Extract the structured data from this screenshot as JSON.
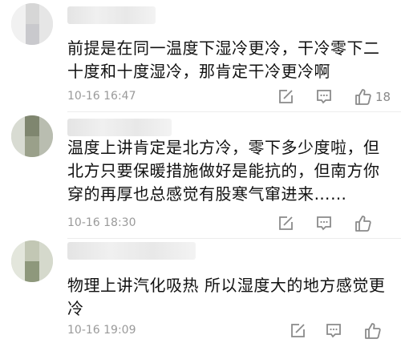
{
  "comments": [
    {
      "text": "前提是在同一温度下湿冷更冷，干冷零下二十度和十度湿冷，那肯定干冷更冷啊",
      "time": "10-16 16:47",
      "likes": "18",
      "actions": {
        "edit_icon": "edit-square-icon",
        "comment_icon": "speech-bubble-icon",
        "like_icon": "thumbs-up-icon"
      }
    },
    {
      "text": "温度上讲肯定是北方冷，零下多少度啦，但北方只要保暖措施做好是能抗的，但南方你穿的再厚也总感觉有股寒气窜进来……",
      "time": "10-16 18:30",
      "likes": "",
      "actions": {
        "edit_icon": "edit-square-icon",
        "comment_icon": "speech-bubble-icon",
        "like_icon": "thumbs-up-icon"
      }
    },
    {
      "text": "物理上讲汽化吸热 所以湿度大的地方感觉更冷",
      "time": "10-16 19:09",
      "likes": "",
      "actions": {
        "edit_icon": "edit-square-icon",
        "comment_icon": "speech-bubble-icon",
        "like_icon": "thumbs-up-icon"
      }
    }
  ],
  "colors": {
    "text": "#111111",
    "meta": "#9a9a9a",
    "icon": "#8a8a8a",
    "background": "#ffffff"
  }
}
